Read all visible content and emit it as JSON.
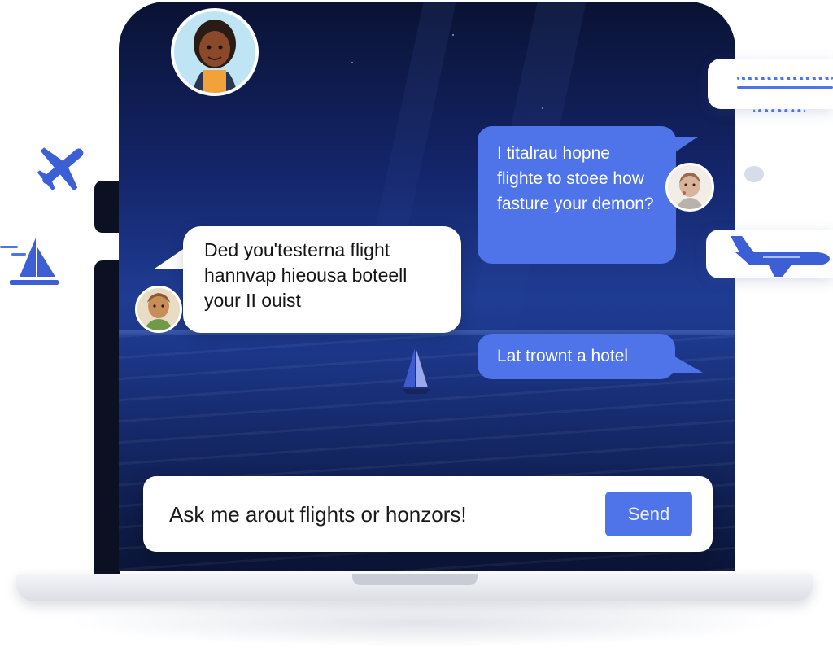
{
  "chat": {
    "messages": [
      {
        "role": "agent",
        "text": "Ded you'testerna flight hannvap hieousa boteell your II ouist"
      },
      {
        "role": "user",
        "text": "I titalrau hopne flighte to stoee how fasture your demon?"
      },
      {
        "role": "user",
        "text": "Lat trownt a hotel"
      }
    ]
  },
  "composer": {
    "placeholder": "Ask me arout flights or honzors!",
    "send_label": "Send"
  },
  "colors": {
    "accent": "#4f74ea",
    "screen_top": "#0a1233",
    "screen_mid": "#1f3c93",
    "bubble_in": "#ffffff",
    "bubble_out": "#4f74ea"
  },
  "icons": [
    "airplane-icon",
    "sailboat-icon",
    "airplane-icon",
    "sailboat-icon",
    "cloud-icon"
  ]
}
